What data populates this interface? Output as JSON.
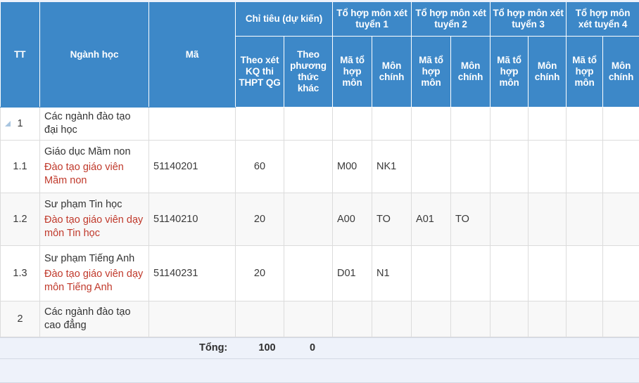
{
  "table": {
    "header": {
      "tt": "TT",
      "nganh_hoc": "Ngành học",
      "ma": "Mã",
      "chi_tieu_group": "Chỉ tiêu (dự kiến)",
      "chi_tieu_thpt": "Theo xét KQ thi THPT QG",
      "chi_tieu_khac": "Theo phương thức khác",
      "group1": "Tổ hợp môn xét tuyển 1",
      "group2": "Tổ hợp môn xét tuyển 2",
      "group3": "Tổ hợp môn xét tuyển 3",
      "group4": "Tổ hợp môn xét tuyển 4",
      "ma_to_hop_mon": "Mã tổ hợp môn",
      "mon_chinh": "Môn chính"
    },
    "rows": [
      {
        "tt": "1",
        "has_toggle": true,
        "name_main": "Các ngành đào tạo đại học",
        "name_sub": "",
        "ma": "",
        "chi_tieu_thpt": "",
        "chi_tieu_khac": "",
        "g1_ma": "",
        "g1_mon": "",
        "g2_ma": "",
        "g2_mon": "",
        "g3_ma": "",
        "g3_mon": "",
        "g4_ma": "",
        "g4_mon": ""
      },
      {
        "tt": "1.1",
        "has_toggle": false,
        "name_main": "Giáo dục Mầm non",
        "name_sub": "Đào tạo giáo viên Mầm non",
        "ma": "51140201",
        "chi_tieu_thpt": "60",
        "chi_tieu_khac": "",
        "g1_ma": "M00",
        "g1_mon": "NK1",
        "g2_ma": "",
        "g2_mon": "",
        "g3_ma": "",
        "g3_mon": "",
        "g4_ma": "",
        "g4_mon": ""
      },
      {
        "tt": "1.2",
        "has_toggle": false,
        "name_main": "Sư phạm Tin học",
        "name_sub": "Đào tạo giáo viên dạy môn Tin học",
        "ma": "51140210",
        "chi_tieu_thpt": "20",
        "chi_tieu_khac": "",
        "g1_ma": "A00",
        "g1_mon": "TO",
        "g2_ma": "A01",
        "g2_mon": "TO",
        "g3_ma": "",
        "g3_mon": "",
        "g4_ma": "",
        "g4_mon": ""
      },
      {
        "tt": "1.3",
        "has_toggle": false,
        "name_main": "Sư phạm Tiếng Anh",
        "name_sub": "Đào tạo giáo viên dạy môn Tiếng Anh",
        "ma": "51140231",
        "chi_tieu_thpt": "20",
        "chi_tieu_khac": "",
        "g1_ma": "D01",
        "g1_mon": "N1",
        "g2_ma": "",
        "g2_mon": "",
        "g3_ma": "",
        "g3_mon": "",
        "g4_ma": "",
        "g4_mon": ""
      },
      {
        "tt": "2",
        "has_toggle": false,
        "name_main": "Các ngành đào tạo cao đẳng",
        "name_sub": "",
        "ma": "",
        "chi_tieu_thpt": "",
        "chi_tieu_khac": "",
        "g1_ma": "",
        "g1_mon": "",
        "g2_ma": "",
        "g2_mon": "",
        "g3_ma": "",
        "g3_mon": "",
        "g4_ma": "",
        "g4_mon": ""
      }
    ],
    "footer": {
      "label": "Tổng:",
      "total_thpt": "100",
      "total_khac": "0"
    }
  },
  "colors": {
    "header_blue": "#3d88c8",
    "sub_name_red": "#c0392b",
    "footer_band": "#eef2fa",
    "grid_line": "#dcdcdc",
    "toggle_triangle": "#a8c5e0"
  }
}
